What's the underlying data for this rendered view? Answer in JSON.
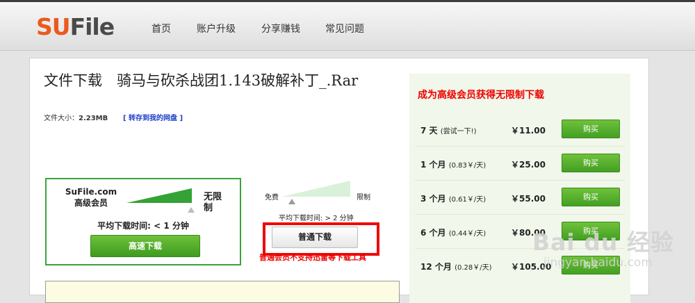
{
  "header": {
    "logo_su": "SU",
    "logo_file": "File",
    "nav": [
      "首页",
      "账户升级",
      "分享赚钱",
      "常见问题"
    ]
  },
  "file": {
    "heading": "文件下载　骑马与砍杀战团1.143破解补丁_.Rar",
    "size_label": "文件大小：",
    "size_value": "2.23MB",
    "save_link": "[ 转存到我的网盘 ]"
  },
  "high_speed": {
    "name_line1": "SuFile.com",
    "name_line2": "高级会员",
    "unlimited": "无限制",
    "avg_time": "平均下载时间: < 1 分钟",
    "button": "高速下载",
    "wedge_color": "#34a234",
    "speed_level": 1.0
  },
  "normal": {
    "free_label": "免费",
    "limit_label": "限制",
    "avg_time": "平均下载时间: > 2 分钟",
    "button": "普通下载",
    "note": "普通会员不支持迅雷等下载工具",
    "wedge_color": "#d9f1d9",
    "speed_level": 0.1
  },
  "pricing": {
    "title": "成为高级会员获得无限制下载",
    "plans": [
      {
        "period": "7 天",
        "detail": "(尝试一下!)",
        "price": "￥11.00",
        "buy": "购买"
      },
      {
        "period": "1 个月",
        "detail": "(0.83￥/天)",
        "price": "￥25.00",
        "buy": "购买"
      },
      {
        "period": "3 个月",
        "detail": "(0.61￥/天)",
        "price": "￥55.00",
        "buy": "购买"
      },
      {
        "period": "6 个月",
        "detail": "(0.44￥/天)",
        "price": "￥80.00",
        "buy": "购买"
      },
      {
        "period": "12 个月",
        "detail": "(0.28￥/天)",
        "price": "￥105.00",
        "buy": "购买"
      }
    ]
  },
  "watermark": {
    "main": "Bai du 经验",
    "sub": "jingyan.baidu.com"
  },
  "colors": {
    "accent_orange": "#ea5a1e",
    "green_button": "#43a023",
    "highlight_red": "#ee0a0a",
    "pricing_bg": "#f1f7ea"
  }
}
